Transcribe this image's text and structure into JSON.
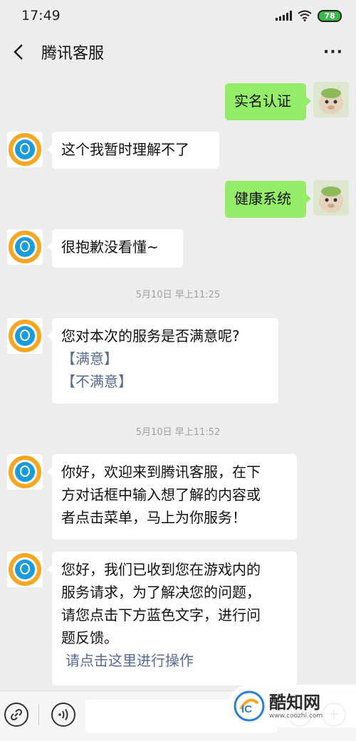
{
  "status_bar": {
    "time": "17:49",
    "battery": "78"
  },
  "header": {
    "title": "腾讯客服"
  },
  "messages": {
    "m1": "实名认证",
    "m2": "这个我暂时理解不了",
    "m3": "健康系统",
    "m4": "很抱歉没看懂~",
    "t1": "5月10日 早上11:25",
    "m5": {
      "text": "您对本次的服务是否满意呢?",
      "opt1": "【满意】",
      "opt2": "【不满意】"
    },
    "t2": "5月10日 早上11:52",
    "m6": [
      "你好，欢迎来到腾讯客服，在下",
      "方对话框中输入想了解的内容或",
      "者点击菜单，马上为你服务！"
    ],
    "m7": [
      "您好，我们已收到您在游戏内的",
      "服务请求，为了解决您的问题，",
      "请您点击下方蓝色文字，进行问",
      "题反馈。"
    ],
    "m7_link": "请点击这里进行操作"
  },
  "watermark": {
    "name": "酷知网",
    "url": "www.coozhi.com"
  },
  "colors": {
    "outgoing_bubble": "#95ec69",
    "link": "#576b95",
    "background": "#ededed"
  }
}
